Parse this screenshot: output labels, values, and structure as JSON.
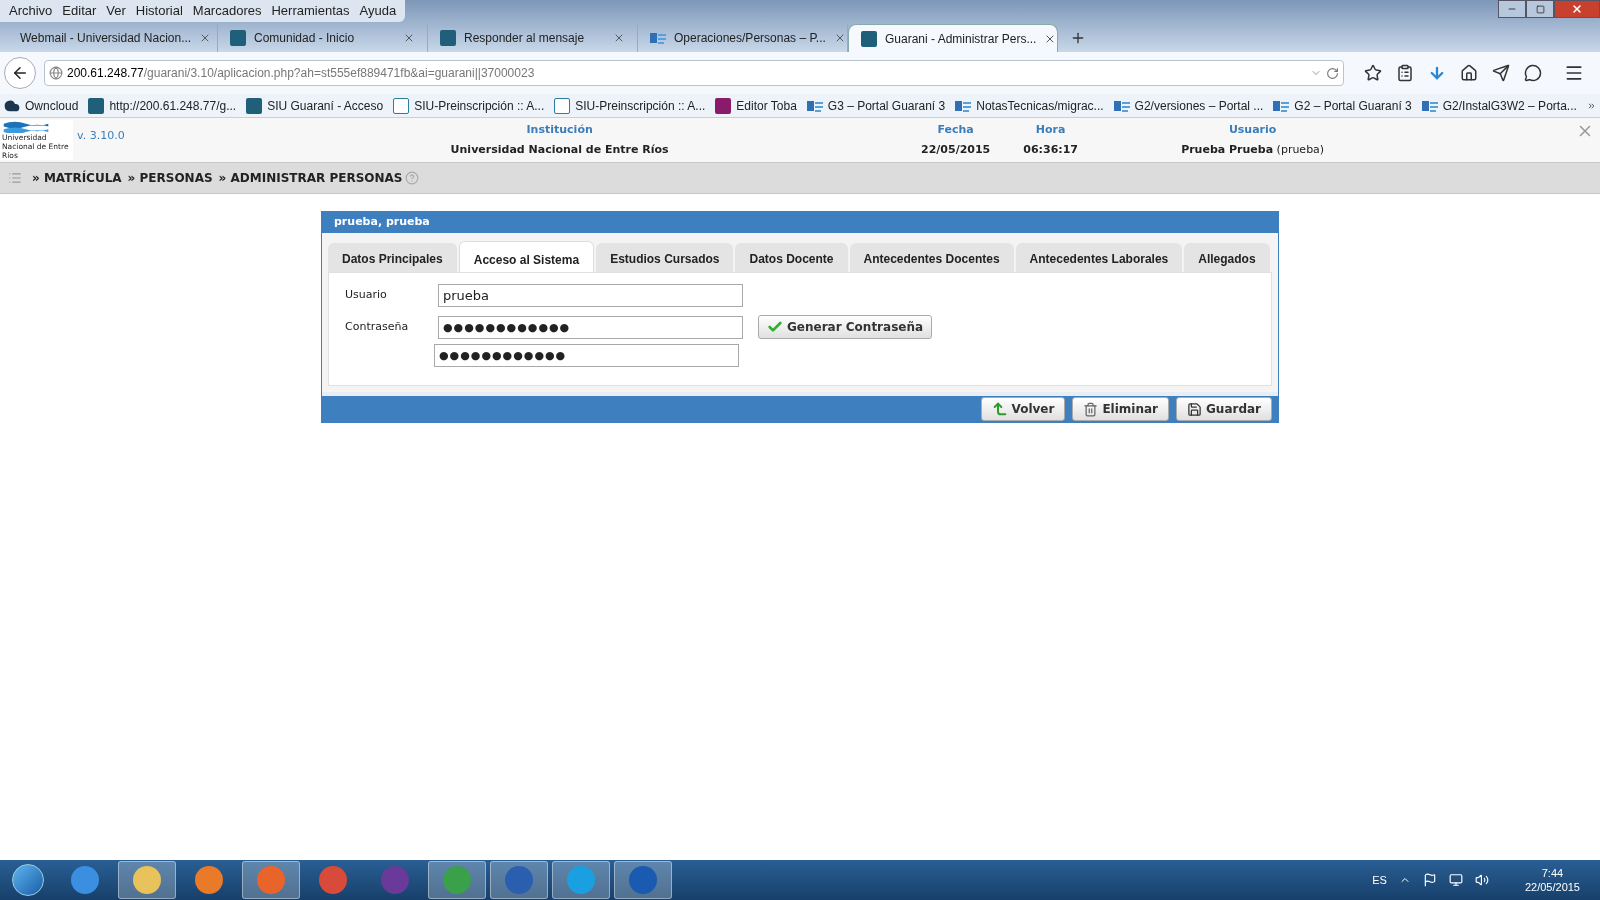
{
  "menu_bar": [
    "Archivo",
    "Editar",
    "Ver",
    "Historial",
    "Marcadores",
    "Herramientas",
    "Ayuda"
  ],
  "browser_tabs": [
    {
      "title": "Webmail - Universidad Nacion...",
      "kind": "plain",
      "selected": false
    },
    {
      "title": "Comunidad - Inicio",
      "kind": "siu",
      "selected": false
    },
    {
      "title": "Responder al mensaje",
      "kind": "siu",
      "selected": false
    },
    {
      "title": "Operaciones/Personas – P...",
      "kind": "wiki",
      "selected": false
    },
    {
      "title": "Guarani - Administrar Pers...",
      "kind": "siu",
      "selected": true
    }
  ],
  "address_bar": {
    "host": "200.61.248.77",
    "path": "/guarani/3.10/aplicacion.php?ah=st555ef889471fb&ai=guarani||37000023"
  },
  "bookmarks": [
    {
      "label": "Owncloud",
      "kind": "cloud"
    },
    {
      "label": "http://200.61.248.77/g...",
      "kind": "siu"
    },
    {
      "label": "SIU Guaraní - Acceso",
      "kind": "siu"
    },
    {
      "label": "SIU-Preinscripción :: A...",
      "kind": "light"
    },
    {
      "label": "SIU-Preinscripción :: A...",
      "kind": "light"
    },
    {
      "label": "Editor Toba",
      "kind": "toba"
    },
    {
      "label": "G3 – Portal Guaraní 3",
      "kind": "wiki"
    },
    {
      "label": "NotasTecnicas/migrac...",
      "kind": "wiki"
    },
    {
      "label": "G2/versiones – Portal ...",
      "kind": "wiki"
    },
    {
      "label": "G2 – Portal Guaraní 3",
      "kind": "wiki"
    },
    {
      "label": "G2/InstalG3W2 – Porta...",
      "kind": "wiki"
    }
  ],
  "app_header": {
    "logo_text": "Universidad Nacional de Entre Ríos",
    "version": "v. 3.10.0",
    "fields": [
      {
        "label": "Institución",
        "value": "Universidad Nacional de Entre Ríos"
      },
      {
        "label": "Fecha",
        "value": "22/05/2015"
      },
      {
        "label": "Hora",
        "value": "06:36:17"
      },
      {
        "label": "Usuario",
        "value": "**Prueba Prueba** (prueba)"
      }
    ]
  },
  "breadcrumb": [
    "» MATRÍCULA",
    "» PERSONAS",
    "» ADMINISTRAR PERSONAS"
  ],
  "panel": {
    "title": "prueba, prueba",
    "tabs": [
      {
        "label": "Datos Principales",
        "selected": false
      },
      {
        "label": "Acceso al Sistema",
        "selected": true
      },
      {
        "label": "Estudios Cursados",
        "selected": false
      },
      {
        "label": "Datos Docente",
        "selected": false
      },
      {
        "label": "Antecedentes Docentes",
        "selected": false
      },
      {
        "label": "Antecedentes Laborales",
        "selected": false
      },
      {
        "label": "Allegados",
        "selected": false
      }
    ],
    "form": {
      "usuario_label": "Usuario",
      "usuario_value": "prueba",
      "password_label": "Contraseña",
      "password_value": "●●●●●●●●●●●●",
      "password_confirm_value": "●●●●●●●●●●●●",
      "generate_button": "Generar Contraseña"
    },
    "actions": [
      {
        "label": "Volver",
        "kind": "back"
      },
      {
        "label": "Eliminar",
        "kind": "delete"
      },
      {
        "label": "Guardar",
        "kind": "save"
      }
    ]
  },
  "taskbar": {
    "language": "ES",
    "time": "7:44",
    "date": "22/05/2015"
  }
}
